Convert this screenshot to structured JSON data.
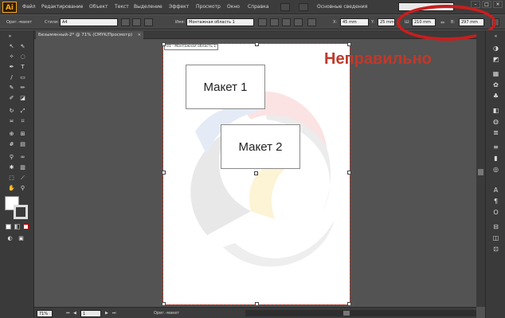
{
  "app": {
    "logo": "Ai"
  },
  "menu": [
    "Файл",
    "Редактирование",
    "Объект",
    "Текст",
    "Выделение",
    "Эффект",
    "Просмотр",
    "Окно",
    "Справка"
  ],
  "workspace": "Основные сведения",
  "window_buttons": [
    "–",
    "□",
    "×"
  ],
  "controlbar": {
    "selection_label": "Ориг.-макет",
    "styles_label": "Стили:",
    "preset_value": "A4",
    "name_label": "Имя:",
    "name_value": "Монтажная область 1",
    "x_label": "X:",
    "x_value": "45 mm",
    "y_label": "Y:",
    "y_value": "25 mm",
    "w_label": "Ш:",
    "w_value": "210 mm",
    "h_label": "В:",
    "h_value": "297 mm"
  },
  "document_tab": {
    "title": "Безымянный-2* @ 71% (CMYK/Просмотр)",
    "close": "×"
  },
  "artboard": {
    "label": "01 - Монтажная область 1"
  },
  "frames": [
    {
      "label": "Макет 1"
    },
    {
      "label": "Макет 2"
    }
  ],
  "annotation": {
    "text": "Неправильно",
    "color": "#c0392b",
    "highlight_color": "#c81e1e"
  },
  "statusbar": {
    "zoom": "71%",
    "artboard_number": "1",
    "tool_name": "Ориг.-макет"
  },
  "toolbox_icons": [
    "selection-tool",
    "direct-selection-tool",
    "magic-wand-tool",
    "lasso-tool",
    "pen-tool",
    "type-tool",
    "line-tool",
    "rectangle-tool",
    "paintbrush-tool",
    "pencil-tool",
    "blob-brush-tool",
    "eraser-tool",
    "rotate-tool",
    "scale-tool",
    "width-tool",
    "free-transform-tool",
    "shape-builder-tool",
    "perspective-grid-tool",
    "mesh-tool",
    "gradient-tool",
    "eyedropper-tool",
    "blend-tool",
    "symbol-sprayer-tool",
    "column-graph-tool",
    "artboard-tool",
    "slice-tool",
    "hand-tool",
    "zoom-tool"
  ],
  "panel_icons": [
    "color-panel",
    "color-guide-panel",
    "swatches-panel",
    "brushes-panel",
    "symbols-panel",
    "graphic-styles-panel",
    "appearance-panel",
    "layers-panel",
    "stroke-panel",
    "gradient-panel",
    "transparency-panel",
    "character-panel",
    "paragraph-panel",
    "opentype-panel",
    "align-panel",
    "pathfinder-panel",
    "transform-panel"
  ]
}
